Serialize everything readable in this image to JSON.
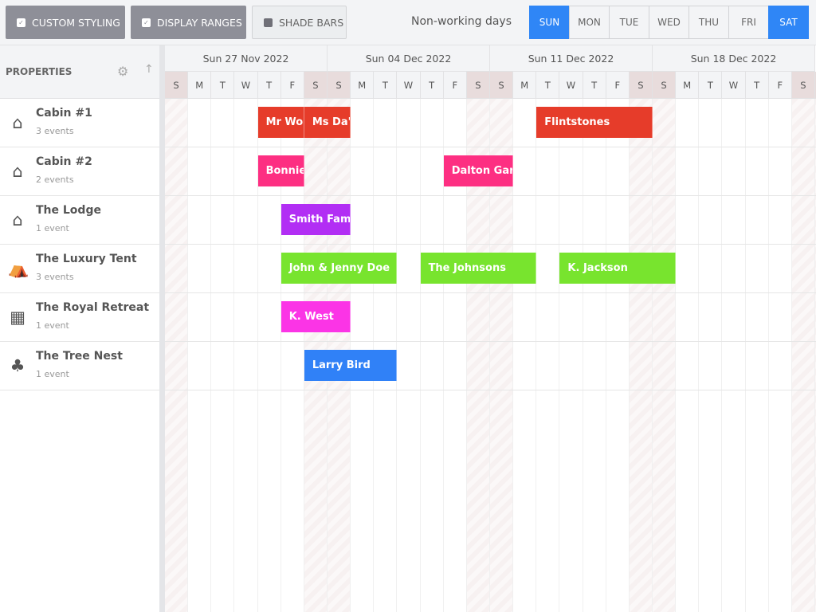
{
  "toolbar": {
    "buttons": [
      {
        "label": "CUSTOM STYLING",
        "checked": true
      },
      {
        "label": "DISPLAY RANGES",
        "checked": true
      },
      {
        "label": "SHADE BARS",
        "checked": false
      }
    ],
    "nonworking_label": "Non-working days",
    "days": [
      {
        "label": "SUN",
        "active": true
      },
      {
        "label": "MON",
        "active": false
      },
      {
        "label": "TUE",
        "active": false
      },
      {
        "label": "WED",
        "active": false
      },
      {
        "label": "THU",
        "active": false
      },
      {
        "label": "FRI",
        "active": false
      },
      {
        "label": "SAT",
        "active": true
      }
    ]
  },
  "sidebar": {
    "header": "PROPERTIES",
    "resources": [
      {
        "name": "Cabin #1",
        "events": "3 events",
        "icon": "house-icon"
      },
      {
        "name": "Cabin #2",
        "events": "2 events",
        "icon": "house-icon"
      },
      {
        "name": "The Lodge",
        "events": "1 event",
        "icon": "house-icon"
      },
      {
        "name": "The Luxury Tent",
        "events": "3 events",
        "icon": "tent-icon"
      },
      {
        "name": "The Royal Retreat",
        "events": "1 event",
        "icon": "building-icon"
      },
      {
        "name": "The Tree Nest",
        "events": "1 event",
        "icon": "tree-icon"
      }
    ]
  },
  "timeline": {
    "weeks": [
      "Sun 27 Nov 2022",
      "Sun 04 Dec 2022",
      "Sun 11 Dec 2022",
      "Sun 18 Dec 2022"
    ],
    "day_letters": [
      "S",
      "M",
      "T",
      "W",
      "T",
      "F",
      "S"
    ],
    "events": [
      {
        "resource": 0,
        "name": "Mr Wo",
        "start": "2022-12-01",
        "days": 2,
        "color": "#e63c2a"
      },
      {
        "resource": 0,
        "name": "Ms Da'",
        "start": "2022-12-03",
        "days": 2,
        "color": "#e63c2a"
      },
      {
        "resource": 0,
        "name": "Flintstones",
        "start": "2022-12-13",
        "days": 5,
        "color": "#e63c2a"
      },
      {
        "resource": 1,
        "name": "Bonnie",
        "start": "2022-12-01",
        "days": 2,
        "color": "#fd2f82"
      },
      {
        "resource": 1,
        "name": "Dalton Gar",
        "start": "2022-12-09",
        "days": 3,
        "color": "#fd2f82"
      },
      {
        "resource": 2,
        "name": "Smith Fam",
        "start": "2022-12-02",
        "days": 3,
        "color": "#b22ef4"
      },
      {
        "resource": 3,
        "name": "John & Jenny Doe",
        "start": "2022-12-02",
        "days": 5,
        "color": "#78e42e"
      },
      {
        "resource": 3,
        "name": "The Johnsons",
        "start": "2022-12-08",
        "days": 5,
        "color": "#78e42e"
      },
      {
        "resource": 3,
        "name": "K. Jackson",
        "start": "2022-12-14",
        "days": 5,
        "color": "#78e42e"
      },
      {
        "resource": 4,
        "name": "K. West",
        "start": "2022-12-02",
        "days": 3,
        "color": "#fb34e6"
      },
      {
        "resource": 5,
        "name": "Larry Bird",
        "start": "2022-12-03",
        "days": 4,
        "color": "#3081f7"
      }
    ]
  }
}
